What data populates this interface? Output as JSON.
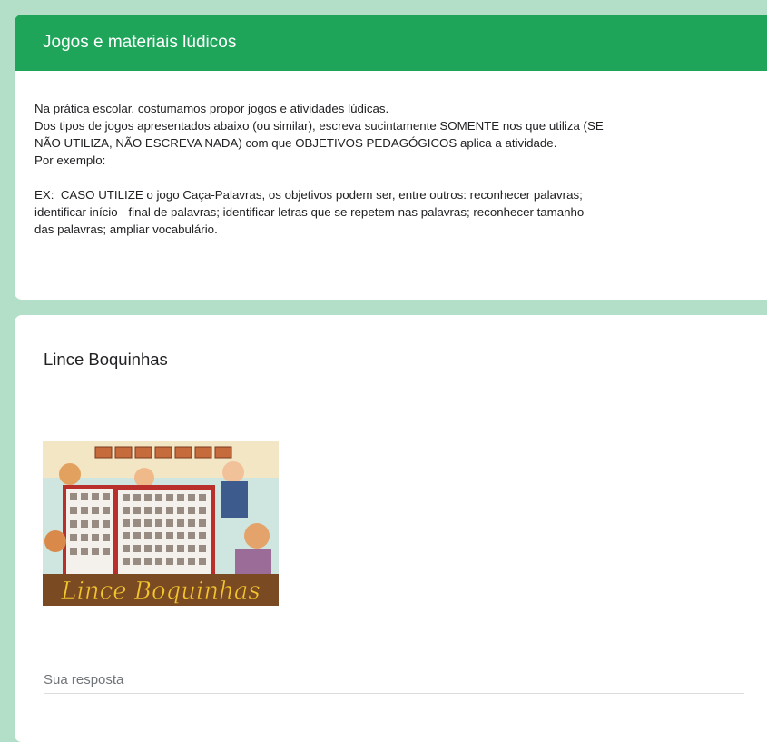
{
  "section": {
    "title": "Jogos e materiais lúdicos",
    "description": [
      "Na prática escolar, costumamos propor jogos e atividades lúdicas.",
      "Dos tipos de jogos apresentados abaixo (ou similar), escreva sucintamente SOMENTE nos que utiliza (SE",
      "NÃO UTILIZA, NÃO ESCREVA NADA) com que OBJETIVOS PEDAGÓGICOS aplica a atividade.",
      "Por exemplo:",
      "",
      "EX:  CASO UTILIZE o jogo Caça-Palavras, os objetivos podem ser, entre outros: reconhecer palavras;",
      "identificar início - final de palavras; identificar letras que se repetem nas palavras; reconhecer tamanho",
      "das palavras; ampliar vocabulário."
    ]
  },
  "question": {
    "title": "Lince Boquinhas",
    "image_caption": "Lince Boquinhas",
    "answer_placeholder": "Sua resposta"
  },
  "colors": {
    "accent": "#1ea559",
    "background": "#b3dfc8"
  }
}
